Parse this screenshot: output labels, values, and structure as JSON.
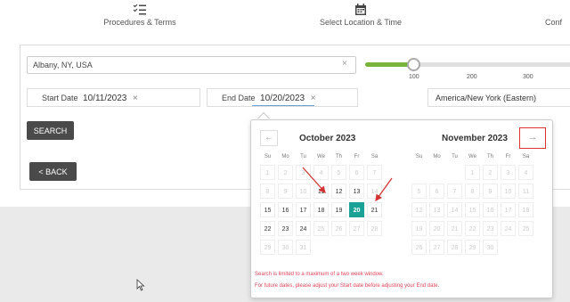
{
  "steps": [
    {
      "label": "Procedures & Terms",
      "icon": "checklist-icon"
    },
    {
      "label": "Select Location & Time",
      "icon": "calendar-icon"
    },
    {
      "label": "Conf"
    }
  ],
  "location": {
    "value": "Albany, NY, USA",
    "clear": "×"
  },
  "slider": {
    "ticks": [
      "100",
      "200",
      "300"
    ],
    "level": 100
  },
  "start": {
    "label": "Start Date",
    "value": "10/11/2023",
    "clear": "×"
  },
  "end": {
    "label": "End Date",
    "value": "10/20/2023",
    "clear": "×"
  },
  "timezone": "America/New York (Eastern)",
  "buttons": {
    "search": "SEARCH",
    "back": "< BACK"
  },
  "picker": {
    "prev": "←",
    "next": "→",
    "dow": [
      "Su",
      "Mo",
      "Tu",
      "We",
      "Th",
      "Fr",
      "Sa"
    ],
    "months": [
      {
        "title": "October 2023",
        "rows": [
          [
            "1",
            "2",
            "3",
            "4",
            "5",
            "6",
            "7"
          ],
          [
            "8",
            "9",
            "10",
            "11",
            "12",
            "13",
            "14"
          ],
          [
            "15",
            "16",
            "17",
            "18",
            "19",
            "20",
            "21"
          ],
          [
            "22",
            "23",
            "24",
            "25",
            "26",
            "27",
            "28"
          ],
          [
            "29",
            "30",
            "31"
          ]
        ]
      },
      {
        "title": "November 2023",
        "rows": [
          [
            "",
            "",
            "",
            "1",
            "2",
            "3",
            "4"
          ],
          [
            "5",
            "6",
            "7",
            "8",
            "9",
            "10",
            "11"
          ],
          [
            "12",
            "13",
            "14",
            "15",
            "16",
            "17",
            "18"
          ],
          [
            "19",
            "20",
            "21",
            "22",
            "23",
            "24",
            "25"
          ],
          [
            "26",
            "27",
            "28",
            "29",
            "30"
          ]
        ]
      }
    ],
    "warnings": [
      "Search is limited to a maximum of a two week window.",
      "For future dates, please adjust your Start date before adjusting your End date."
    ]
  },
  "colors": {
    "accent": "#1ba195",
    "slider": "#78b43a",
    "warning": "#e0455a",
    "highlight": "#d33333"
  }
}
